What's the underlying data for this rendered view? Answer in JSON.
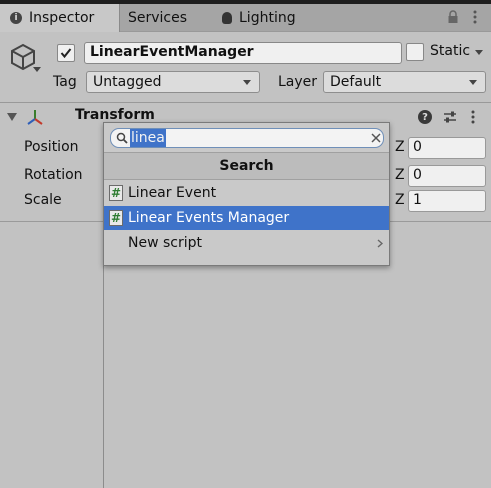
{
  "tabs": [
    {
      "label": "Inspector",
      "icon": "info-icon",
      "active": true
    },
    {
      "label": "Services",
      "active": false
    },
    {
      "label": "Lighting",
      "icon": "bulb-icon",
      "active": false
    }
  ],
  "header_icons": [
    "lock-icon",
    "tab-menu-icon"
  ],
  "game_object": {
    "active": true,
    "name": "LinearEventManager",
    "static_label": "Static",
    "static": false,
    "tag_label": "Tag",
    "tag_value": "Untagged",
    "layer_label": "Layer",
    "layer_value": "Default"
  },
  "transform": {
    "title": "Transform",
    "rows": [
      {
        "label": "Position",
        "z_label": "Z",
        "z_value": "0"
      },
      {
        "label": "Rotation",
        "z_label": "Z",
        "z_value": "0"
      },
      {
        "label": "Scale",
        "z_label": "Z",
        "z_value": "1"
      }
    ],
    "help_icon": "?"
  },
  "popup": {
    "search_value": "linea",
    "header": "Search",
    "items": [
      {
        "label": "Linear Event",
        "icon": "script-icon",
        "selected": false
      },
      {
        "label": "Linear Events Manager",
        "icon": "script-icon",
        "selected": true
      },
      {
        "label": "New script",
        "icon": "chevron-right-icon",
        "selected": false
      }
    ],
    "script_glyph": "#"
  },
  "colors": {
    "background": "#c2c2c2",
    "selection": "#3f73c9",
    "tab_bar": "#a5a5a5"
  }
}
